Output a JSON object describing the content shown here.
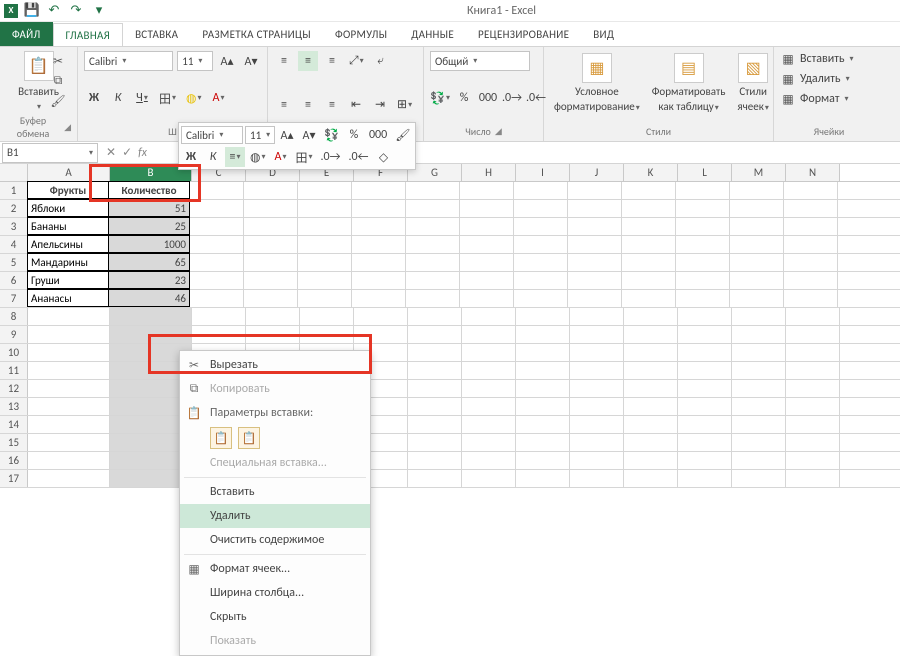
{
  "window": {
    "title": "Книга1 - Excel"
  },
  "qat": {
    "save": "💾",
    "undo": "↶",
    "redo": "↷"
  },
  "tabs": {
    "file": "ФАЙЛ",
    "home": "ГЛАВНАЯ",
    "insert": "ВСТАВКА",
    "page": "РАЗМЕТКА СТРАНИЦЫ",
    "formulas": "ФОРМУЛЫ",
    "data": "ДАННЫЕ",
    "review": "РЕЦЕНЗИРОВАНИЕ",
    "view": "ВИД"
  },
  "ribbon": {
    "clipboard": {
      "paste": "Вставить",
      "label": "Буфер обмена"
    },
    "font": {
      "name": "Calibri",
      "size": "11",
      "label": "Ш"
    },
    "number": {
      "format": "Общий",
      "label": "Число"
    },
    "styles": {
      "cond": "Условное",
      "cond2": "форматирование",
      "fmt": "Форматировать",
      "fmt2": "как таблицу",
      "cell": "Стили",
      "cell2": "ячеек",
      "label": "Стили"
    },
    "cells": {
      "insert": "Вставить",
      "delete": "Удалить",
      "format": "Формат",
      "label": "Ячейки"
    }
  },
  "namebox": {
    "ref": "B1"
  },
  "columns": [
    "A",
    "B",
    "C",
    "D",
    "E",
    "F",
    "G",
    "H",
    "I",
    "J",
    "K",
    "L",
    "M",
    "N"
  ],
  "rows": [
    "1",
    "2",
    "3",
    "4",
    "5",
    "6",
    "7",
    "8",
    "9",
    "10",
    "11",
    "12",
    "13",
    "14",
    "15",
    "16",
    "17"
  ],
  "data": {
    "header": [
      "Фрукты",
      "Количество"
    ],
    "body": [
      [
        "Яблоки",
        "51"
      ],
      [
        "Бананы",
        "25"
      ],
      [
        "Апельсины",
        "1000"
      ],
      [
        "Мандарины",
        "65"
      ],
      [
        "Груши",
        "23"
      ],
      [
        "Ананасы",
        "46"
      ]
    ]
  },
  "mini": {
    "font": "Calibri",
    "size": "11"
  },
  "context": {
    "cut": "Вырезать",
    "copy": "Копировать",
    "paste_opts": "Параметры вставки:",
    "paste_special": "Специальная вставка...",
    "insert": "Вставить",
    "delete": "Удалить",
    "clear": "Очистить содержимое",
    "format_cells": "Формат ячеек...",
    "col_width": "Ширина столбца...",
    "hide": "Скрыть",
    "show": "Показать"
  },
  "chart_data": {
    "type": "table",
    "title": "",
    "columns": [
      "Фрукты",
      "Количество"
    ],
    "rows": [
      [
        "Яблоки",
        51
      ],
      [
        "Бананы",
        25
      ],
      [
        "Апельсины",
        1000
      ],
      [
        "Мандарины",
        65
      ],
      [
        "Груши",
        23
      ],
      [
        "Ананасы",
        46
      ]
    ]
  }
}
